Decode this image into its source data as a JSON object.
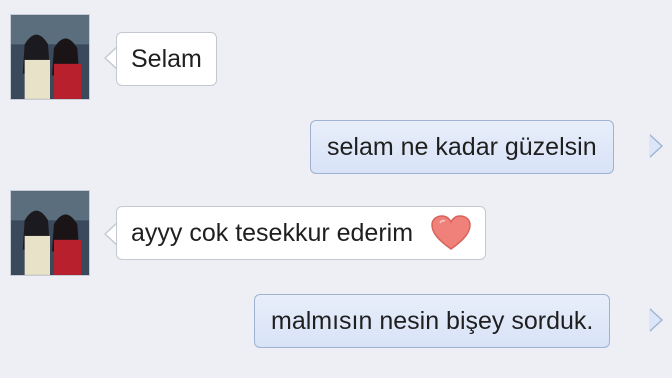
{
  "colors": {
    "background": "#edeff4",
    "incoming_bubble": "#ffffff",
    "outgoing_bubble": "#dce6f8",
    "heart": "#f0807a"
  },
  "messages": [
    {
      "direction": "incoming",
      "text": "Selam",
      "has_avatar": true
    },
    {
      "direction": "outgoing",
      "text": "selam ne kadar güzelsin"
    },
    {
      "direction": "incoming",
      "text": "ayyy cok tesekkur ederim",
      "has_avatar": true,
      "emoji": "heart-icon"
    },
    {
      "direction": "outgoing",
      "text": "malmısın nesin bişey sorduk."
    }
  ]
}
